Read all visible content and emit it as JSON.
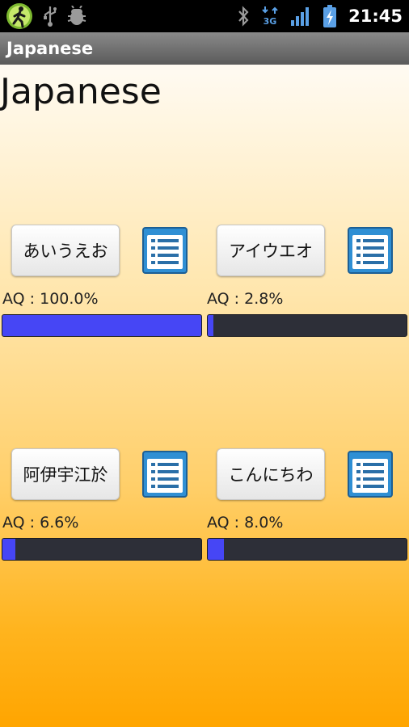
{
  "status_bar": {
    "time": "21:45",
    "icons": [
      "walker-app-icon",
      "usb-icon",
      "android-debug-icon",
      "bluetooth-icon",
      "network-3g-icon",
      "signal-icon",
      "battery-charging-icon"
    ]
  },
  "app": {
    "title_bar": "Japanese",
    "heading": "Japanese"
  },
  "colors": {
    "progress_fill": "#4646f5",
    "progress_track": "#2d2f38",
    "list_icon": "#2f8fd4",
    "background_bottom": "#ffa500"
  },
  "cells": [
    {
      "button_label": "あいうえお",
      "aq_text": "AQ : 100.0%",
      "progress": 1.0
    },
    {
      "button_label": "アイウエオ",
      "aq_text": "AQ : 2.8%",
      "progress": 0.028
    },
    {
      "button_label": "阿伊宇江於",
      "aq_text": "AQ : 6.6%",
      "progress": 0.066
    },
    {
      "button_label": "こんにちわ",
      "aq_text": "AQ : 8.0%",
      "progress": 0.08
    }
  ]
}
